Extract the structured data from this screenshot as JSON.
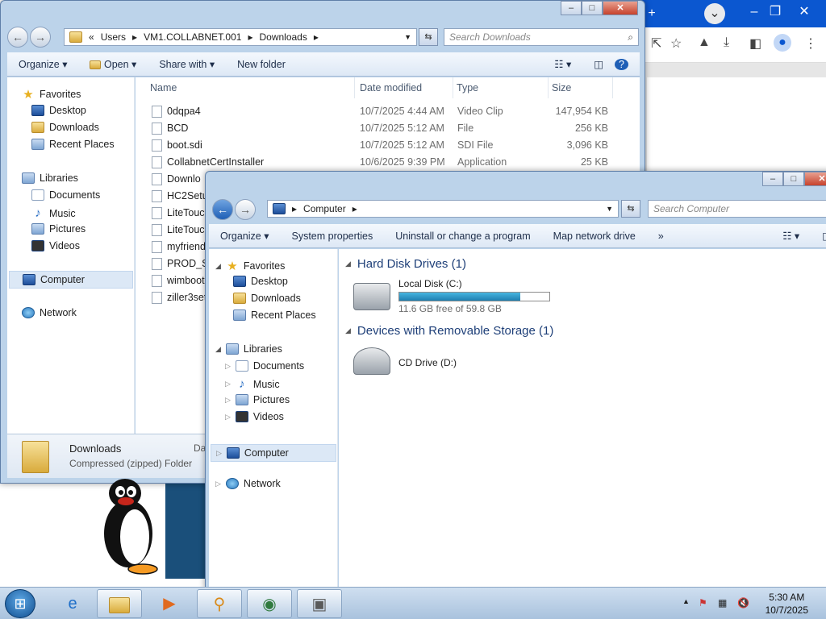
{
  "downloads_window": {
    "breadcrumb": [
      "«",
      "Users",
      "VM1.COLLABNET.001",
      "Downloads"
    ],
    "search_placeholder": "Search Downloads",
    "toolbar": [
      "Organize",
      "Open",
      "Share with",
      "New folder"
    ],
    "columns": [
      "Name",
      "Date modified",
      "Type",
      "Size"
    ],
    "nav": {
      "favorites": "Favorites",
      "fav_items": [
        "Desktop",
        "Downloads",
        "Recent Places"
      ],
      "libraries": "Libraries",
      "lib_items": [
        "Documents",
        "Music",
        "Pictures",
        "Videos"
      ],
      "computer": "Computer",
      "network": "Network"
    },
    "files": [
      {
        "name": "0dqpa4",
        "date": "10/7/2025 4:44 AM",
        "type": "Video Clip",
        "size": "147,954 KB"
      },
      {
        "name": "BCD",
        "date": "10/7/2025 5:12 AM",
        "type": "File",
        "size": "256 KB"
      },
      {
        "name": "boot.sdi",
        "date": "10/7/2025 5:12 AM",
        "type": "SDI File",
        "size": "3,096 KB"
      },
      {
        "name": "CollabnetCertInstaller",
        "date": "10/6/2025 9:39 PM",
        "type": "Application",
        "size": "25 KB"
      },
      {
        "name": "Downlo",
        "date": "",
        "type": "",
        "size": ""
      },
      {
        "name": "HC2Setu",
        "date": "",
        "type": "",
        "size": ""
      },
      {
        "name": "LiteTouc",
        "date": "",
        "type": "",
        "size": ""
      },
      {
        "name": "LiteTouc",
        "date": "",
        "type": "",
        "size": ""
      },
      {
        "name": "myfriend",
        "date": "",
        "type": "",
        "size": ""
      },
      {
        "name": "PROD_St",
        "date": "",
        "type": "",
        "size": ""
      },
      {
        "name": "wimboot",
        "date": "",
        "type": "",
        "size": ""
      },
      {
        "name": "ziller3set",
        "date": "",
        "type": "",
        "size": ""
      }
    ],
    "details": {
      "name": "Downloads",
      "type": "Compressed (zipped) Folder",
      "extra": "Da"
    }
  },
  "computer_window": {
    "breadcrumb": [
      "Computer"
    ],
    "search_placeholder": "Search Computer",
    "toolbar": [
      "Organize",
      "System properties",
      "Uninstall or change a program",
      "Map network drive",
      "»"
    ],
    "nav": {
      "favorites": "Favorites",
      "fav_items": [
        "Desktop",
        "Downloads",
        "Recent Places"
      ],
      "libraries": "Libraries",
      "lib_items": [
        "Documents",
        "Music",
        "Pictures",
        "Videos"
      ],
      "computer": "Computer",
      "network": "Network"
    },
    "groups": [
      {
        "title": "Hard Disk Drives (1)"
      },
      {
        "title": "Devices with Removable Storage (1)"
      }
    ],
    "local_disk": {
      "name": "Local Disk (C:)",
      "free_text": "11.6 GB free of 59.8 GB",
      "used_fraction": 0.806
    },
    "cd_drive": {
      "name": "CD Drive (D:)"
    }
  },
  "taskbar": {
    "time": "5:30 AM",
    "date": "10/7/2025",
    "tray_chevron": "▲"
  },
  "colors": {
    "accent": "#0b57d0",
    "bar_fill": "#2a8ec0"
  }
}
